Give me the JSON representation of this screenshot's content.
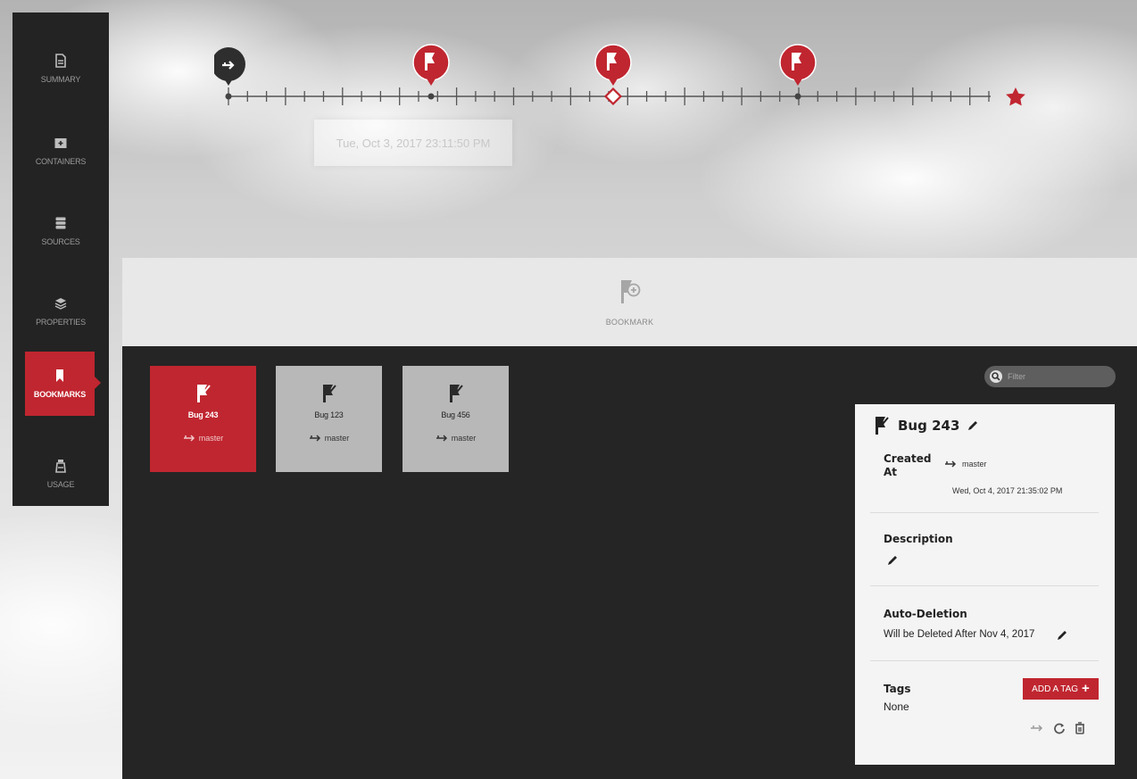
{
  "sidebar": {
    "items": [
      {
        "label": "SUMMARY",
        "icon": "document-icon"
      },
      {
        "label": "CONTAINERS",
        "icon": "container-icon"
      },
      {
        "label": "SOURCES",
        "icon": "database-icon"
      },
      {
        "label": "PROPERTIES",
        "icon": "layers-icon"
      },
      {
        "label": "BOOKMARKS",
        "icon": "bookmark-icon",
        "active": true
      },
      {
        "label": "USAGE",
        "icon": "usage-icon"
      }
    ]
  },
  "timeline": {
    "tooltip_date": "Tue, Oct 3, 2017 23:11:50 PM"
  },
  "bookmark_bar": {
    "label": "BOOKMARK"
  },
  "filter": {
    "placeholder": "Filter"
  },
  "cards": [
    {
      "name": "Bug 243",
      "branch": "master",
      "active": true
    },
    {
      "name": "Bug 123",
      "branch": "master",
      "active": false
    },
    {
      "name": "Bug 456",
      "branch": "master",
      "active": false
    }
  ],
  "detail": {
    "title": "Bug 243",
    "created_at_label": "Created At",
    "created_branch": "master",
    "created_date": "Wed, Oct 4, 2017 21:35:02 PM",
    "description_label": "Description",
    "auto_deletion_label": "Auto-Deletion",
    "auto_deletion_text": "Will be Deleted After Nov 4, 2017",
    "tags_label": "Tags",
    "tags_value": "None",
    "add_tag_label": "ADD A TAG"
  },
  "colors": {
    "accent": "#c02630",
    "sidebar_bg": "#232323",
    "main_bg": "#252525"
  }
}
